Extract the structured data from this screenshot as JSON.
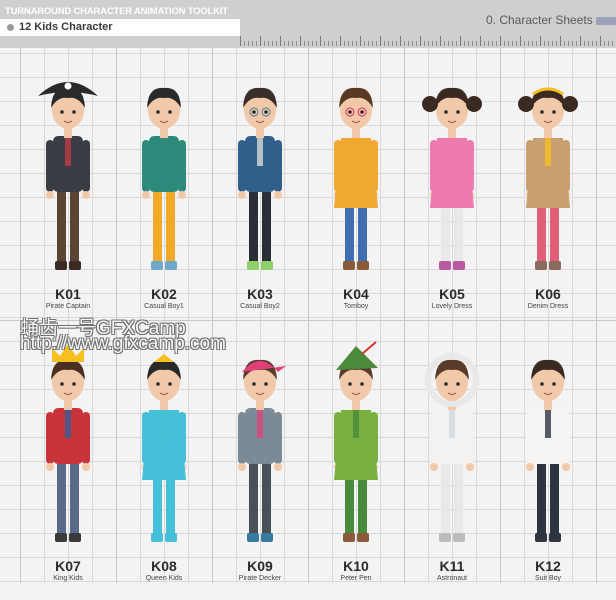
{
  "header": {
    "toolkit_title": "TURNAROUND CHARACTER ANIMATION TOOLKIT",
    "subtitle": "12 Kids Character",
    "sheet_label": "0. Character Sheets"
  },
  "characters": [
    {
      "code": "K01",
      "name": "Pirate Captain",
      "hair": "#2a2a2a",
      "skin": "#f2c9a8",
      "shirt": "#3a3e44",
      "pants": "#5b4433",
      "shoes": "#3a2a22",
      "hat": "pirate",
      "accent": "#c23b4a"
    },
    {
      "code": "K02",
      "name": "Casual Boy1",
      "hair": "#2a2a2a",
      "skin": "#f2c9a8",
      "shirt": "#2e8a7a",
      "pants": "#f0a928",
      "shoes": "#6fa8c8",
      "hat": "none",
      "accent": "#2e8a7a"
    },
    {
      "code": "K03",
      "name": "Casual Boy2",
      "hair": "#3a2e28",
      "skin": "#f2c9a8",
      "shirt": "#2f5f8a",
      "pants": "#2a2f36",
      "shoes": "#8fcf6a",
      "hat": "glasses",
      "accent": "#d8d8d8"
    },
    {
      "code": "K04",
      "name": "Tomboy",
      "hair": "#5a3a22",
      "skin": "#f2c9a8",
      "shirt": "#f0a930",
      "pants": "#3f6fb0",
      "shoes": "#8a5a3a",
      "hat": "glasses-pink",
      "accent": "#f0a930"
    },
    {
      "code": "K05",
      "name": "Lovely Dress",
      "hair": "#3a2a22",
      "skin": "#f2c9a8",
      "shirt": "#f07ab0",
      "pants": "#e8e8e8",
      "shoes": "#b85aa0",
      "hat": "pigtails",
      "accent": "#f07ab0"
    },
    {
      "code": "K06",
      "name": "Denim Dress",
      "hair": "#3a2a22",
      "skin": "#f2c9a8",
      "shirt": "#c8a070",
      "pants": "#e0607a",
      "shoes": "#8a6a5a",
      "hat": "headband",
      "accent": "#f5c020"
    },
    {
      "code": "K07",
      "name": "King Kids",
      "hair": "#4a3020",
      "skin": "#f2c9a8",
      "shirt": "#c9343a",
      "pants": "#5a6a8a",
      "shoes": "#3a3a3a",
      "hat": "crown",
      "accent": "#2f5f9a"
    },
    {
      "code": "K08",
      "name": "Queen Kids",
      "hair": "#2a2a2a",
      "skin": "#f2c9a8",
      "shirt": "#45c0d8",
      "pants": "#45c0d8",
      "shoes": "#45c0d8",
      "hat": "tiara",
      "accent": "#45c0d8"
    },
    {
      "code": "K09",
      "name": "Pirate Decker",
      "hair": "#5a3a2a",
      "skin": "#f2c9a8",
      "shirt": "#7a8a96",
      "pants": "#4a5058",
      "shoes": "#3a7aa0",
      "hat": "bandana",
      "accent": "#e0407a"
    },
    {
      "code": "K10",
      "name": "Peter Pen",
      "hair": "#5a3a2a",
      "skin": "#f2c9a8",
      "shirt": "#7ab040",
      "pants": "#4a8a3a",
      "shoes": "#8a5a3a",
      "hat": "peter",
      "accent": "#4a8a3a"
    },
    {
      "code": "K11",
      "name": "Astronaut",
      "hair": "#5a3a2a",
      "skin": "#f2c9a8",
      "shirt": "#f2f2f2",
      "pants": "#e8e8e8",
      "shoes": "#bcbcbc",
      "hat": "helmet",
      "accent": "#cfd8e0"
    },
    {
      "code": "K12",
      "name": "Suit Boy",
      "hair": "#3a2a22",
      "skin": "#f2c9a8",
      "shirt": "#f5f5f5",
      "pants": "#2e3440",
      "shoes": "#2e3440",
      "hat": "none",
      "accent": "#2e3440"
    }
  ],
  "watermark": {
    "line1": "蛹齿一号GFXCamp",
    "line2": "http://www.gfxcamp.com"
  }
}
